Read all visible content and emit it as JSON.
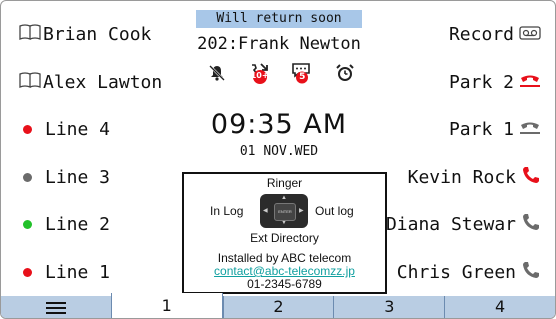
{
  "left_keys": [
    {
      "label": "Brian Cook",
      "icon": "book-icon"
    },
    {
      "label": "Alex Lawton",
      "icon": "book-icon"
    },
    {
      "label": "Line 4",
      "dot_color": "#e8101a"
    },
    {
      "label": "Line 3",
      "dot_color": "#6b6b6b"
    },
    {
      "label": "Line 2",
      "dot_color": "#22c12a"
    },
    {
      "label": "Line 1",
      "dot_color": "#e8101a"
    }
  ],
  "right_keys": [
    {
      "label": "Record",
      "icon": "voicemail-icon"
    },
    {
      "label": "Park 2",
      "icon": "park-active-icon"
    },
    {
      "label": "Park 1",
      "icon": "park-idle-icon"
    },
    {
      "label": "Kevin Rock",
      "icon": "phone-red-icon"
    },
    {
      "label": "Diana Stewar",
      "icon": "phone-gray-icon"
    },
    {
      "label": "Chris Green",
      "icon": "phone-gray-icon"
    }
  ],
  "status": {
    "banner": "Will return soon",
    "caller": "202:Frank Newton",
    "missed_calls": "10+",
    "messages": "5",
    "time": "09:35 AM",
    "date": "01 NOV.WED"
  },
  "nav": {
    "up": "Ringer",
    "left": "In Log",
    "right": "Out log",
    "down": "Ext Directory",
    "center": "ENTER",
    "installed": "Installed by ABC telecom",
    "email": "contact@abc-telecomzz.jp",
    "phone": "01-2345-6789"
  },
  "tabs": [
    "1",
    "2",
    "3",
    "4"
  ],
  "colors": {
    "red": "#e8101a",
    "tab_bg": "#b9cde3",
    "banner_bg": "#a8c7e8",
    "link": "#11a0a0"
  }
}
